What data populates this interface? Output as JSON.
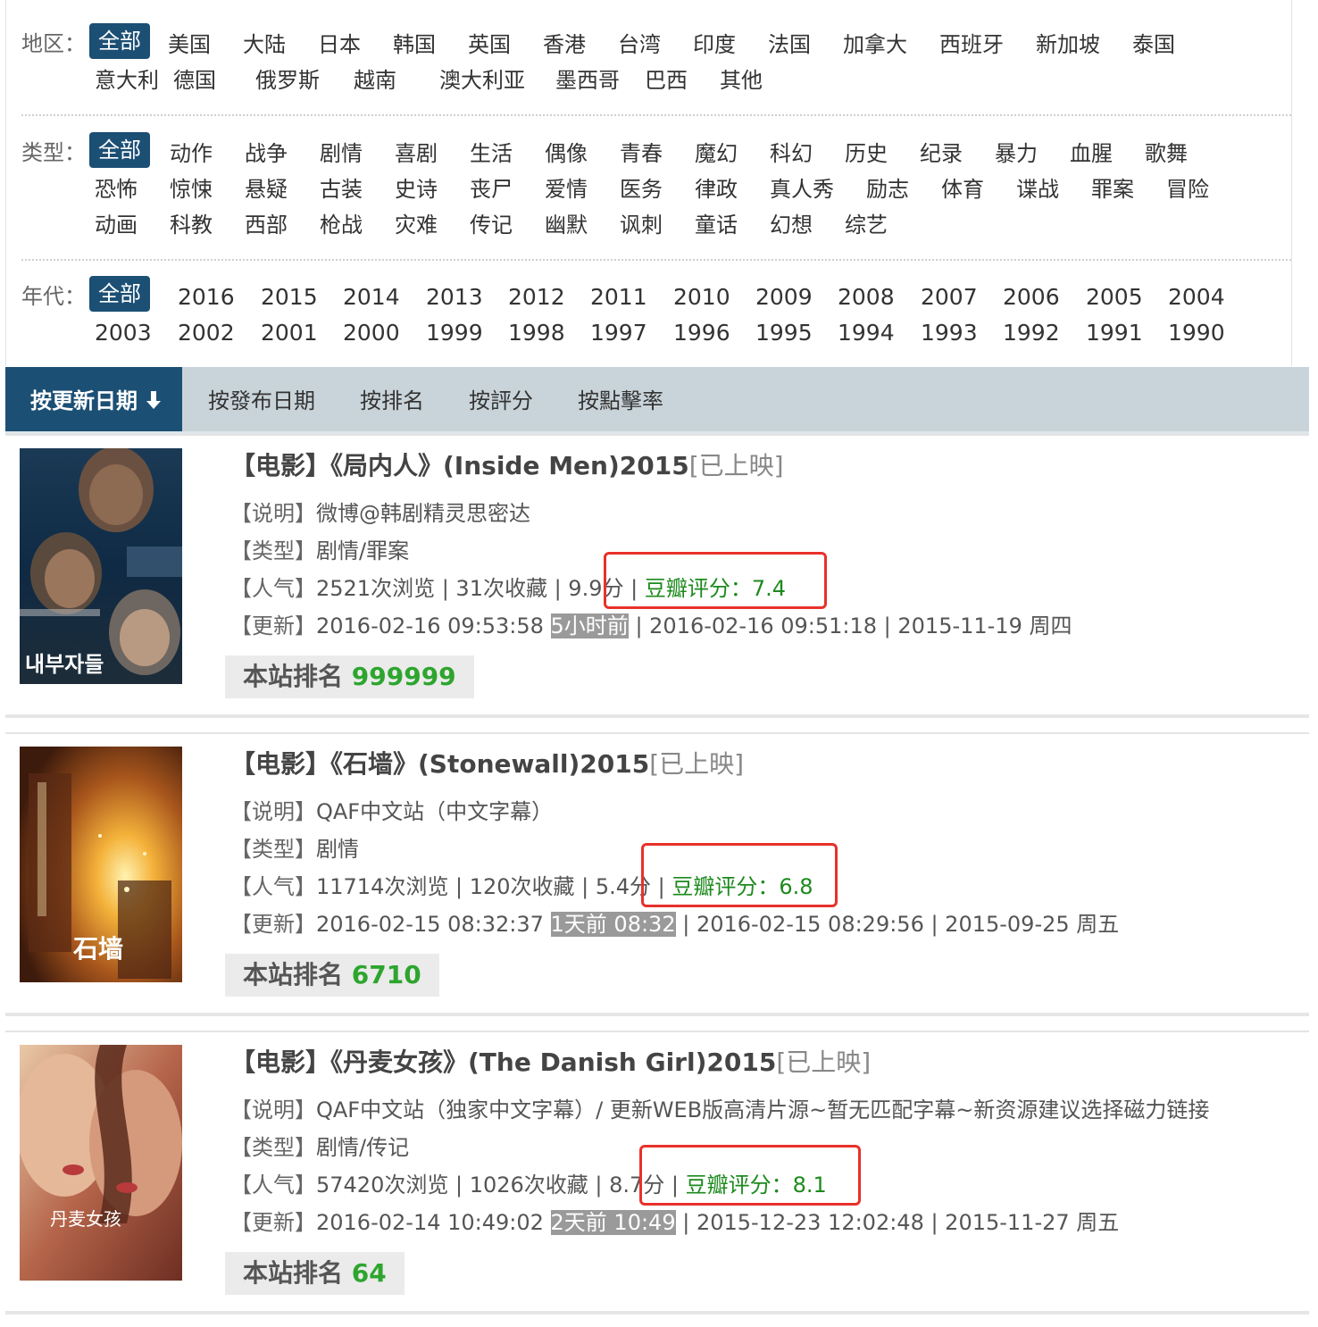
{
  "filters": {
    "region": {
      "label": "地区：",
      "rows": [
        [
          "全部",
          "美国",
          "大陆",
          "日本",
          "韩国",
          "英国",
          "香港",
          "台湾",
          "印度",
          "法国",
          "加拿大",
          "西班牙",
          "新加坡",
          "泰国"
        ],
        [
          "意大利",
          "德国",
          "俄罗斯",
          "越南",
          "澳大利亚",
          "墨西哥",
          "巴西",
          "其他"
        ]
      ]
    },
    "genre": {
      "label": "类型：",
      "rows": [
        [
          "全部",
          "动作",
          "战争",
          "剧情",
          "喜剧",
          "生活",
          "偶像",
          "青春",
          "魔幻",
          "科幻",
          "历史",
          "纪录",
          "暴力",
          "血腥",
          "歌舞"
        ],
        [
          "恐怖",
          "惊悚",
          "悬疑",
          "古装",
          "史诗",
          "丧尸",
          "爱情",
          "医务",
          "律政",
          "真人秀",
          "励志",
          "体育",
          "谍战",
          "罪案",
          "冒险"
        ],
        [
          "动画",
          "科教",
          "西部",
          "枪战",
          "灾难",
          "传记",
          "幽默",
          "讽刺",
          "童话",
          "幻想",
          "综艺"
        ]
      ]
    },
    "year": {
      "label": "年代：",
      "rows": [
        [
          "全部",
          "2016",
          "2015",
          "2014",
          "2013",
          "2012",
          "2011",
          "2010",
          "2009",
          "2008",
          "2007",
          "2006",
          "2005",
          "2004"
        ],
        [
          "2003",
          "2002",
          "2001",
          "2000",
          "1999",
          "1998",
          "1997",
          "1996",
          "1995",
          "1994",
          "1993",
          "1992",
          "1991",
          "1990"
        ]
      ]
    }
  },
  "sort": {
    "tabs": [
      "按更新日期",
      "按發布日期",
      "按排名",
      "按評分",
      "按點擊率"
    ],
    "active": "按更新日期",
    "active_arrow_icon": "arrow-down-icon"
  },
  "colors": {
    "accent": "#1c4f74",
    "sortbar_bg": "#c9d4da",
    "rating_green": "#1d8a1d",
    "rank_green": "#2ea52e",
    "highlight_red": "#e8312a"
  },
  "labels": {
    "desc": "【说明】",
    "type": "【类型】",
    "pop": "【人气】",
    "upd": "【更新】",
    "rank_prefix": "本站排名"
  },
  "movies": [
    {
      "title": "【电影】《局内人》(Inside Men)2015",
      "status": "[已上映]",
      "desc": "微博@韩剧精灵思密达",
      "type": "剧情/罪案",
      "pop_main": "2521次浏览 | 31次收藏 | 9.9分 | ",
      "douban": "豆瓣评分：7.4",
      "upd_main": "2016-02-16 09:53:58 ",
      "upd_badge": "5小时前",
      "upd_rest": " | 2016-02-16 09:51:18 | 2015-11-19 周四",
      "rank": "999999",
      "poster_text": "내부자들"
    },
    {
      "title": "【电影】《石墙》(Stonewall)2015",
      "status": "[已上映]",
      "desc": "QAF中文站（中文字幕）",
      "type": "剧情",
      "pop_main": "11714次浏览 | 120次收藏 | 5.4分 | ",
      "douban": "豆瓣评分：6.8",
      "upd_main": "2016-02-15 08:32:37 ",
      "upd_badge": "1天前 08:32",
      "upd_rest": " | 2016-02-15 08:29:56 | 2015-09-25 周五",
      "rank": "6710",
      "poster_text": "石墙"
    },
    {
      "title": "【电影】《丹麦女孩》(The Danish Girl)2015",
      "status": "[已上映]",
      "desc": "QAF中文站（独家中文字幕）/ 更新WEB版高清片源~暂无匹配字幕~新资源建议选择磁力链接",
      "type": "剧情/传记",
      "pop_main": "57420次浏览 | 1026次收藏 | 8.7分 | ",
      "douban": "豆瓣评分：8.1",
      "upd_main": "2016-02-14 10:49:02 ",
      "upd_badge": "2天前 10:49",
      "upd_rest": " | 2015-12-23 12:02:48 | 2015-11-27 周五",
      "rank": "64",
      "poster_text": "丹麦女孩"
    }
  ]
}
